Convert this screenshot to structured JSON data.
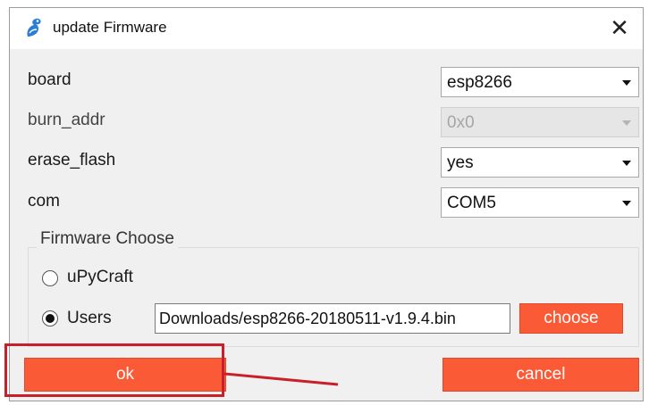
{
  "window": {
    "title": "update Firmware",
    "close_glyph": "✕",
    "app_icon": "uPyCraft-logo-icon"
  },
  "form": {
    "board": {
      "label": "board",
      "value": "esp8266"
    },
    "burn_addr": {
      "label": "burn_addr",
      "value": "0x0",
      "disabled": true
    },
    "erase_flash": {
      "label": "erase_flash",
      "value": "yes"
    },
    "com": {
      "label": "com",
      "value": "COM5"
    }
  },
  "firmware_choose": {
    "legend": "Firmware Choose",
    "options": [
      {
        "label": "uPyCraft",
        "checked": false
      },
      {
        "label": "Users",
        "checked": true
      }
    ],
    "path_value": "Downloads/esp8266-20180511-v1.9.4.bin",
    "choose_label": "choose"
  },
  "buttons": {
    "ok_label": "ok",
    "cancel_label": "cancel"
  },
  "colors": {
    "accent": "#fb5a36",
    "annotation": "#c8202a"
  }
}
